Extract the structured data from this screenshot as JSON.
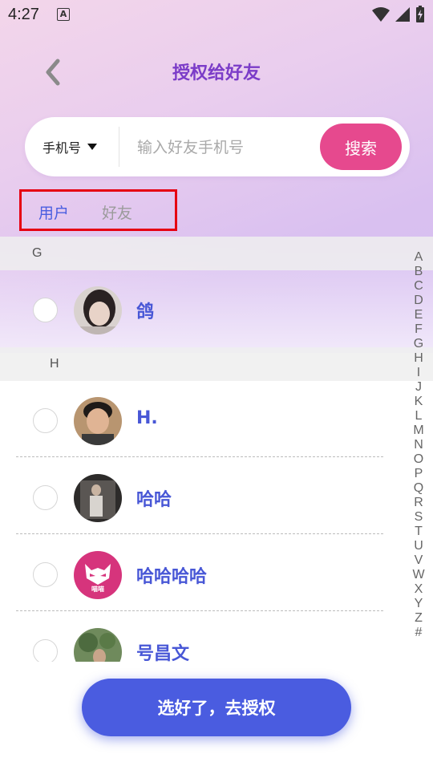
{
  "status_bar": {
    "time": "4:27",
    "app_icon_letter": "A"
  },
  "header": {
    "title": "授权给好友"
  },
  "search": {
    "selector_label": "手机号",
    "placeholder": "输入好友手机号",
    "button_label": "搜索"
  },
  "tabs": [
    {
      "label": "用户",
      "active": true
    },
    {
      "label": "好友",
      "active": false
    }
  ],
  "sections": [
    {
      "letter": "G",
      "contacts": [
        {
          "name": "鸽"
        }
      ]
    },
    {
      "letter": "H",
      "contacts": [
        {
          "name": "H."
        },
        {
          "name": "哈哈"
        },
        {
          "name": "哈哈哈哈"
        },
        {
          "name": "号昌文"
        }
      ]
    }
  ],
  "avatar_badge_text": "喵喵",
  "index_letters": [
    "A",
    "B",
    "C",
    "D",
    "E",
    "F",
    "G",
    "H",
    "I",
    "J",
    "K",
    "L",
    "M",
    "N",
    "O",
    "P",
    "Q",
    "R",
    "S",
    "T",
    "U",
    "V",
    "W",
    "X",
    "Y",
    "Z",
    "#"
  ],
  "confirm_button": {
    "label": "选好了，去授权"
  },
  "colors": {
    "title": "#7b3cc8",
    "search_button": "#e6498e",
    "active_tab": "#4a5ee0",
    "contact_name": "#4857d6",
    "confirm_button": "#4a5ce0",
    "highlight_box": "#e60012"
  }
}
